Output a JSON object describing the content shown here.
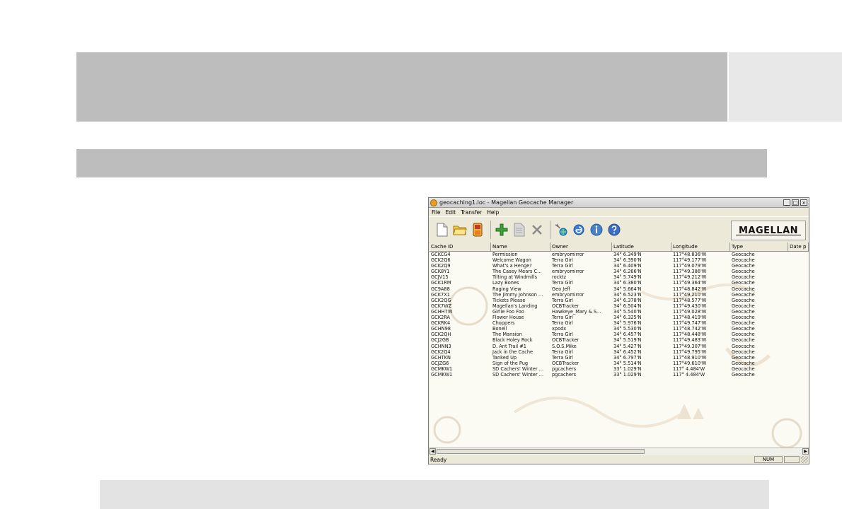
{
  "window": {
    "title": "geocaching1.loc - Magellan Geocache Manager",
    "buttons": {
      "minimize": "_",
      "maximize": "□",
      "close": "x"
    }
  },
  "menu": [
    "File",
    "Edit",
    "Transfer",
    "Help"
  ],
  "toolbar": {
    "icons": [
      "new-document-icon",
      "open-folder-icon",
      "gps-device-icon",
      "add-icon",
      "edit-document-icon",
      "delete-icon",
      "satellite-icon",
      "internet-explorer-icon",
      "info-icon",
      "help-icon"
    ],
    "logo_text": "MAGELLAN"
  },
  "table": {
    "headers": [
      "Cache ID",
      "Name",
      "Owner",
      "Latitude",
      "Longitude",
      "Type",
      "Date p"
    ],
    "rows": [
      [
        "GCKCG4",
        "Permission",
        "embryomirror",
        "34° 6.349'N",
        "117°48.836'W",
        "Geocache"
      ],
      [
        "GCK2Q6",
        "Welcome Wagon",
        "Terra Girl",
        "34° 6.390'N",
        "117°49.177'W",
        "Geocache"
      ],
      [
        "GCK2Q9",
        "What's a Henge?",
        "Terra Girl",
        "34° 6.409'N",
        "117°49.079'W",
        "Geocache"
      ],
      [
        "GCK8Y1",
        "The Casey Mears C...",
        "embryomirror",
        "34° 6.266'N",
        "117°49.386'W",
        "Geocache"
      ],
      [
        "GCJV15",
        "Tilting at Windmills",
        "rocktz",
        "34° 5.749'N",
        "117°49.212'W",
        "Geocache"
      ],
      [
        "GCK1RM",
        "Lazy Bones",
        "Terra Girl",
        "34° 6.380'N",
        "117°49.364'W",
        "Geocache"
      ],
      [
        "GC9A88",
        "Raging View",
        "Geo Jeff",
        "34° 5.664'N",
        "117°48.842'W",
        "Geocache"
      ],
      [
        "GCK7X1",
        "The Jimmy Johnson ...",
        "embryomirror",
        "34° 6.523'N",
        "117°49.210'W",
        "Geocache"
      ],
      [
        "GCK2QG",
        "Tickets Please",
        "Terra Girl",
        "34° 6.378'N",
        "117°48.577'W",
        "Geocache"
      ],
      [
        "GCK7WZ",
        "Magellan's Landing",
        "OCBTracker",
        "34° 6.504'N",
        "117°49.430'W",
        "Geocache"
      ],
      [
        "GCHH7W",
        "Girlie Foo Foo",
        "Hawkeye_Mary & S...",
        "34° 5.540'N",
        "117°49.028'W",
        "Geocache"
      ],
      [
        "GCK2RA",
        "Flower House",
        "Terra Girl",
        "34° 6.325'N",
        "117°48.419'W",
        "Geocache"
      ],
      [
        "GCKRK4",
        "Choppers",
        "Terra Girl",
        "34° 5.976'N",
        "117°49.747'W",
        "Geocache"
      ],
      [
        "GCHN98",
        "Bonell",
        "xpodx",
        "34° 5.530'N",
        "117°48.742'W",
        "Geocache"
      ],
      [
        "GCK2QH",
        "The Mansion",
        "Terra Girl",
        "34° 6.457'N",
        "117°48.448'W",
        "Geocache"
      ],
      [
        "GCJ2GB",
        "Black Holey Rock",
        "OCBTracker",
        "34° 5.519'N",
        "117°49.483'W",
        "Geocache"
      ],
      [
        "GCHNN3",
        "D. Ant Trail #1",
        "S.O.S.Mike",
        "34° 5.427'N",
        "117°49.307'W",
        "Geocache"
      ],
      [
        "GCK2Q4",
        "Jack in the Cache",
        "Terra Girl",
        "34° 6.452'N",
        "117°49.795'W",
        "Geocache"
      ],
      [
        "GCHTKN",
        "Tanked Up",
        "Terra Girl",
        "34° 6.797'N",
        "117°48.910'W",
        "Geocache"
      ],
      [
        "GCJZG6",
        "Sign of the Pug",
        "OCBTracker",
        "34° 5.514'N",
        "117°49.610'W",
        "Geocache"
      ],
      [
        "GCMKW1",
        "SD Cachers' Winter ...",
        "pgcachers",
        "33° 1.029'N",
        "117° 4.484'W",
        "Geocache"
      ],
      [
        "GCMKW1",
        "SD Cachers' Winter ...",
        "pgcachers",
        "33° 1.029'N",
        "117° 4.484'W",
        "Geocache"
      ]
    ]
  },
  "scrollbar": {
    "left_arrow": "◀",
    "right_arrow": "▶"
  },
  "status": {
    "text": "Ready",
    "num": "NUM"
  }
}
